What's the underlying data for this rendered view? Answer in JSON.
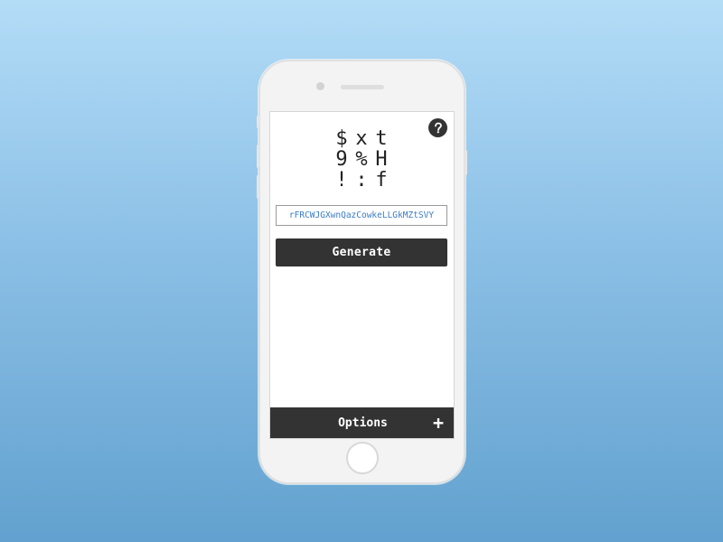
{
  "app": {
    "help_icon": "question-icon",
    "glyph_grid": [
      "$",
      "x",
      "t",
      "9",
      "%",
      "H",
      "!",
      ":",
      "f"
    ],
    "password": {
      "value": "rFRCWJGXwnQazCowkeLLGkMZtSVY"
    },
    "generate_label": "Generate",
    "options_label": "Options",
    "options_toggle": "+"
  },
  "colors": {
    "background_top": "#b3dcf7",
    "background_bottom": "#62a1cf",
    "button": "#333333",
    "password_text": "#3a7cc6"
  }
}
